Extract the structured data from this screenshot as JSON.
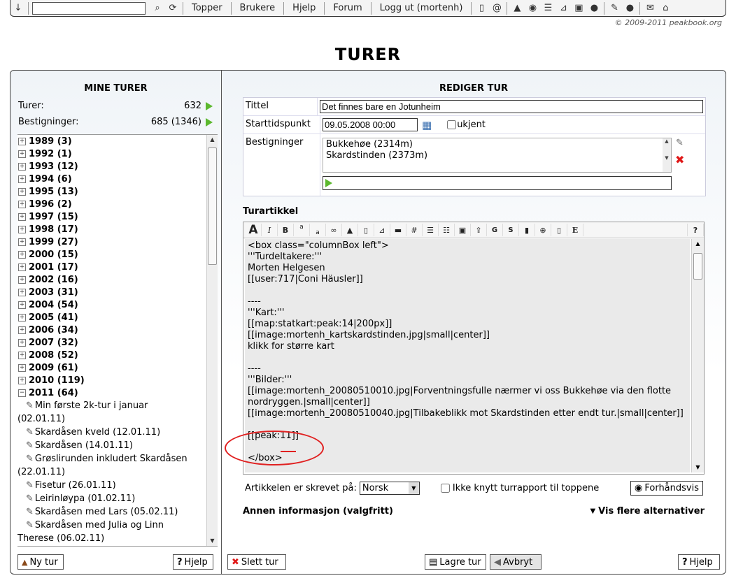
{
  "topbar": {
    "nav": [
      "Topper",
      "Brukere",
      "Hjelp",
      "Forum",
      "Logg ut (mortenh)"
    ],
    "search_value": "",
    "copyright": "© 2009-2011 peakbook.org"
  },
  "page_title": "TURER",
  "left": {
    "heading": "MINE TURER",
    "turer_label": "Turer:",
    "turer_value": "632",
    "bestigninger_label": "Bestigninger:",
    "bestigninger_value": "685 (1346)",
    "years": [
      "1989 (3)",
      "1992 (1)",
      "1993 (12)",
      "1994 (6)",
      "1995 (13)",
      "1996 (2)",
      "1997 (15)",
      "1998 (17)",
      "1999 (27)",
      "2000 (15)",
      "2001 (17)",
      "2002 (16)",
      "2003 (31)",
      "2004 (54)",
      "2005 (41)",
      "2006 (34)",
      "2007 (32)",
      "2008 (52)",
      "2009 (61)",
      "2010 (119)",
      "2011 (64)"
    ],
    "trips": [
      [
        "Min første 2k-tur i januar",
        "(02.01.11)"
      ],
      [
        "Skardåsen kveld (12.01.11)"
      ],
      [
        "Skardåsen (14.01.11)"
      ],
      [
        "Grøslirunden inkludert Skardåsen",
        "(22.01.11)"
      ],
      [
        "Fisetur (26.01.11)"
      ],
      [
        "Leirinløypa (01.02.11)"
      ],
      [
        "Skardåsen med Lars (05.02.11)"
      ],
      [
        "Skardåsen med Julia og Linn",
        "Therese (06.02.11)"
      ]
    ],
    "new_trip_button": "Ny tur",
    "help_button": "Hjelp"
  },
  "right": {
    "heading": "REDIGER TUR",
    "title_label": "Tittel",
    "title_value": "Det finnes bare en Jotunheim",
    "start_label": "Starttidspunkt",
    "start_value": "09.05.2008 00:00",
    "unknown_label": "ukjent",
    "ascents_label": "Bestigninger",
    "ascents": [
      "Bukkehøe (2314m)",
      "Skardstinden (2373m)"
    ],
    "article_label": "Turartikkel",
    "article_text": "<box class=\"columnBox left\">\n'''Turdeltakere:'''\nMorten Helgesen\n[[user:717|Coni Häusler]]\n\n----\n'''Kart:'''\n[[map:statkart:peak:14|200px]]\n[[image:mortenh_kartskardstinden.jpg|small|center]]\nklikk for større kart\n\n----\n'''Bilder:'''\n[[image:mortenh_20080510010.jpg|Forventningsfulle nærmer vi oss Bukkehøe via den flotte nordryggen.|small|center]]\n[[image:mortenh_20080510040.jpg|Tilbakeblikk mot Skardstinden etter endt tur.|small|center]]\n\n[[peak:11]]\n\n</box>",
    "language_label": "Artikkelen er skrevet på:",
    "language_value": "Norsk",
    "no_link_label": "Ikke knytt turrapport til toppene",
    "preview_button": "Forhåndsvis",
    "other_info_label": "Annen informasjon (valgfritt)",
    "more_options": "Vis flere alternativer",
    "delete_button": "Slett tur",
    "save_button": "Lagre tur",
    "cancel_button": "Avbryt",
    "help_button": "Hjelp"
  }
}
